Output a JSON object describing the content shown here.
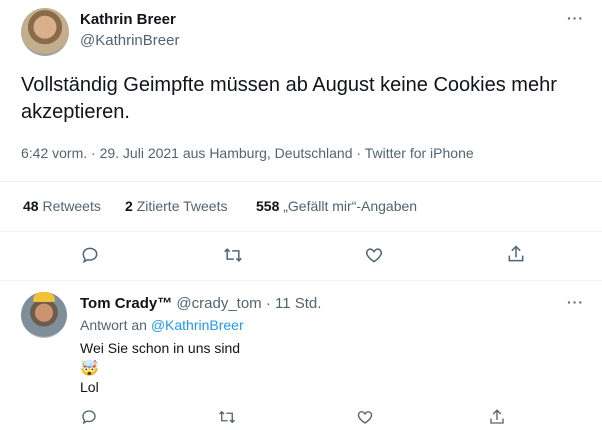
{
  "tweet": {
    "author_name": "Kathrin Breer",
    "author_handle": "@KathrinBreer",
    "text": "Vollständig Geimpfte müssen ab August keine Cookies mehr akzeptieren.",
    "timestamp": "6:42 vorm. · 29. Juli 2021 aus Hamburg, Deutschland · Twitter for iPhone",
    "more_label": "···"
  },
  "stats": {
    "retweets_count": "48",
    "retweets_label": "Retweets",
    "quote_count": "2",
    "quote_label": "Zitierte Tweets",
    "likes_count": "558",
    "likes_label": "„Gefällt mir“-Angaben"
  },
  "reply": {
    "author_name": "Tom Crady™",
    "author_handle": "@crady_tom",
    "time": "· 11 Std.",
    "reply_prefix": "Antwort an",
    "reply_to": "@KathrinBreer",
    "line1": "Wei Sie schon in uns sind",
    "emoji": "🤯",
    "line3": "Lol",
    "more_label": "···"
  },
  "icons": {
    "reply": "reply-icon",
    "retweet": "retweet-icon",
    "like": "heart-icon",
    "share": "share-icon"
  },
  "colors": {
    "link": "#1d9bf0",
    "muted": "#536471",
    "text": "#0f1419"
  }
}
